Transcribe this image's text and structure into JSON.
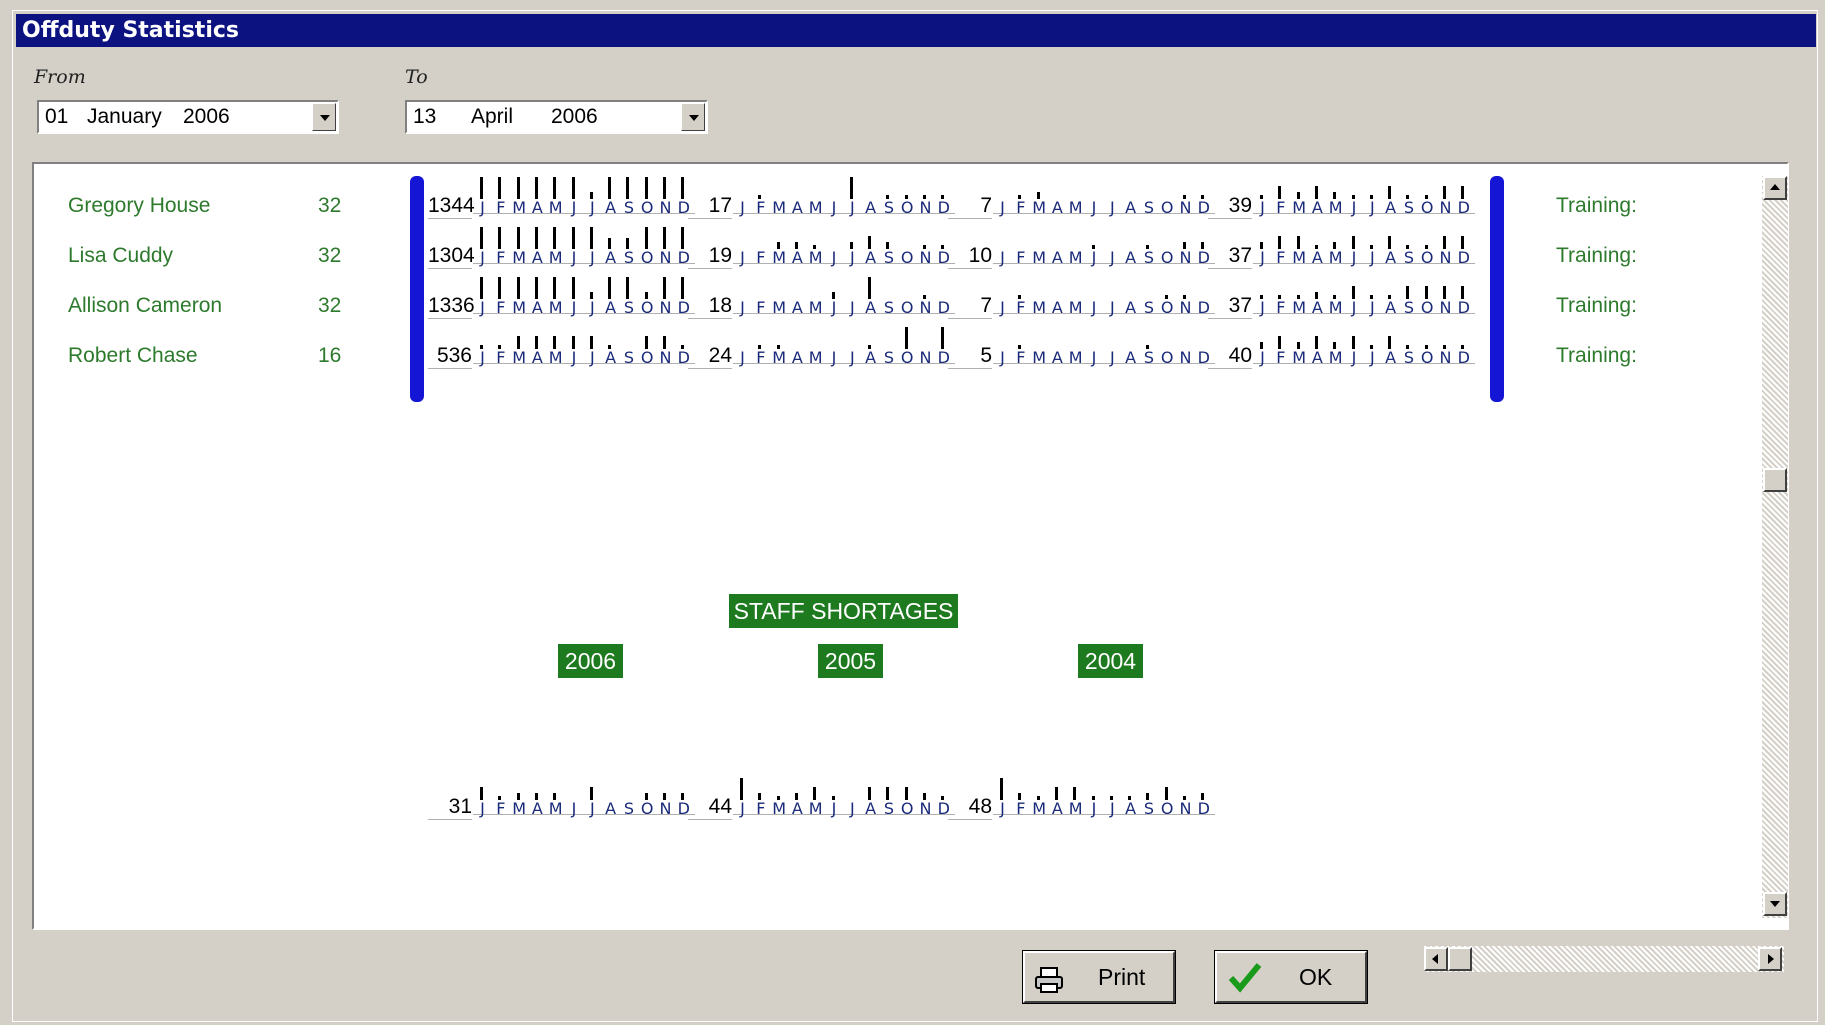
{
  "window": {
    "title": "Offduty Statistics"
  },
  "range": {
    "from_label": "From",
    "to_label": "To",
    "from": {
      "day": "01",
      "month": "January",
      "year": "2006"
    },
    "to": {
      "day": "13",
      "month": "April",
      "year": "2006"
    }
  },
  "months": [
    "J",
    "F",
    "M",
    "A",
    "M",
    "J",
    "J",
    "A",
    "S",
    "O",
    "N",
    "D"
  ],
  "staff": [
    {
      "name": "Gregory House",
      "count": "32",
      "training": "Training:",
      "stats": [
        {
          "value": "1344",
          "levels": [
            1,
            1,
            1,
            1,
            1,
            1,
            0.3,
            1,
            1,
            1,
            1,
            1
          ]
        },
        {
          "value": "17",
          "levels": [
            0,
            0.2,
            0,
            0,
            0,
            0,
            1,
            0,
            0.2,
            0.2,
            0.2,
            0.2
          ]
        },
        {
          "value": "7",
          "levels": [
            0,
            0.2,
            0.3,
            0,
            0,
            0,
            0,
            0,
            0,
            0,
            0.2,
            0.2
          ]
        },
        {
          "value": "39",
          "levels": [
            0.2,
            0.6,
            0.3,
            0.6,
            0.3,
            0.2,
            0.2,
            0.6,
            0.2,
            0.2,
            0.6,
            0.6
          ]
        }
      ]
    },
    {
      "name": "Lisa Cuddy",
      "count": "32",
      "training": "Training:",
      "stats": [
        {
          "value": "1304",
          "levels": [
            1,
            1,
            1,
            1,
            1,
            1,
            1,
            0.5,
            0.5,
            1,
            1,
            1
          ]
        },
        {
          "value": "19",
          "levels": [
            0,
            0,
            0.3,
            0.3,
            0.2,
            0,
            0.3,
            0.6,
            0.3,
            0,
            0.2,
            0.2
          ]
        },
        {
          "value": "10",
          "levels": [
            0,
            0,
            0,
            0,
            0,
            0.2,
            0,
            0,
            0.2,
            0,
            0.3,
            0.3
          ]
        },
        {
          "value": "37",
          "levels": [
            0.3,
            0.6,
            0.6,
            0.2,
            0.3,
            0.6,
            0.2,
            0.6,
            0.2,
            0.2,
            0.6,
            0.6
          ]
        }
      ]
    },
    {
      "name": "Allison Cameron",
      "count": "32",
      "training": "Training:",
      "stats": [
        {
          "value": "1336",
          "levels": [
            1,
            1,
            1,
            1,
            1,
            1,
            0.3,
            1,
            1,
            0.3,
            1,
            1
          ]
        },
        {
          "value": "18",
          "levels": [
            0,
            0,
            0,
            0,
            0,
            0.3,
            0,
            1,
            0,
            0,
            0.2,
            0
          ]
        },
        {
          "value": "7",
          "levels": [
            0,
            0.2,
            0,
            0,
            0,
            0,
            0,
            0,
            0,
            0.2,
            0.2,
            0
          ]
        },
        {
          "value": "37",
          "levels": [
            0.2,
            0.2,
            0.2,
            0.3,
            0.2,
            0.6,
            0.2,
            0.2,
            0.6,
            0.6,
            0.6,
            0.6
          ]
        }
      ]
    },
    {
      "name": "Robert Chase",
      "count": "16",
      "training": "Training:",
      "stats": [
        {
          "value": "536",
          "levels": [
            0.2,
            0.2,
            0.6,
            0.6,
            0.6,
            0.6,
            0.6,
            0.2,
            0,
            0.6,
            0.6,
            0.2
          ]
        },
        {
          "value": "24",
          "levels": [
            0,
            0.2,
            0.2,
            0,
            0,
            0,
            0,
            0.2,
            0,
            1,
            0,
            1
          ]
        },
        {
          "value": "5",
          "levels": [
            0,
            0.2,
            0,
            0,
            0,
            0,
            0,
            0,
            0.2,
            0,
            0,
            0
          ]
        },
        {
          "value": "40",
          "levels": [
            0.3,
            0.6,
            0.3,
            0.6,
            0.3,
            0.6,
            0.2,
            0.6,
            0.2,
            0.2,
            0.2,
            0.2
          ]
        }
      ]
    }
  ],
  "shortages": {
    "title": "STAFF SHORTAGES",
    "years": [
      "2006",
      "2005",
      "2004"
    ],
    "stats": [
      {
        "value": "31",
        "levels": [
          0.6,
          0.2,
          0.3,
          0.3,
          0.3,
          0,
          0.6,
          0,
          0,
          0.3,
          0.3,
          0.3
        ]
      },
      {
        "value": "44",
        "levels": [
          1,
          0.3,
          0.2,
          0.3,
          0.6,
          0.2,
          0,
          0.6,
          0.6,
          0.6,
          0.3,
          0.2
        ]
      },
      {
        "value": "48",
        "levels": [
          1,
          0.3,
          0.2,
          0.6,
          0.6,
          0.2,
          0.2,
          0.2,
          0.3,
          0.6,
          0.2,
          0.3
        ]
      }
    ]
  },
  "buttons": {
    "print": "Print",
    "ok": "OK"
  }
}
